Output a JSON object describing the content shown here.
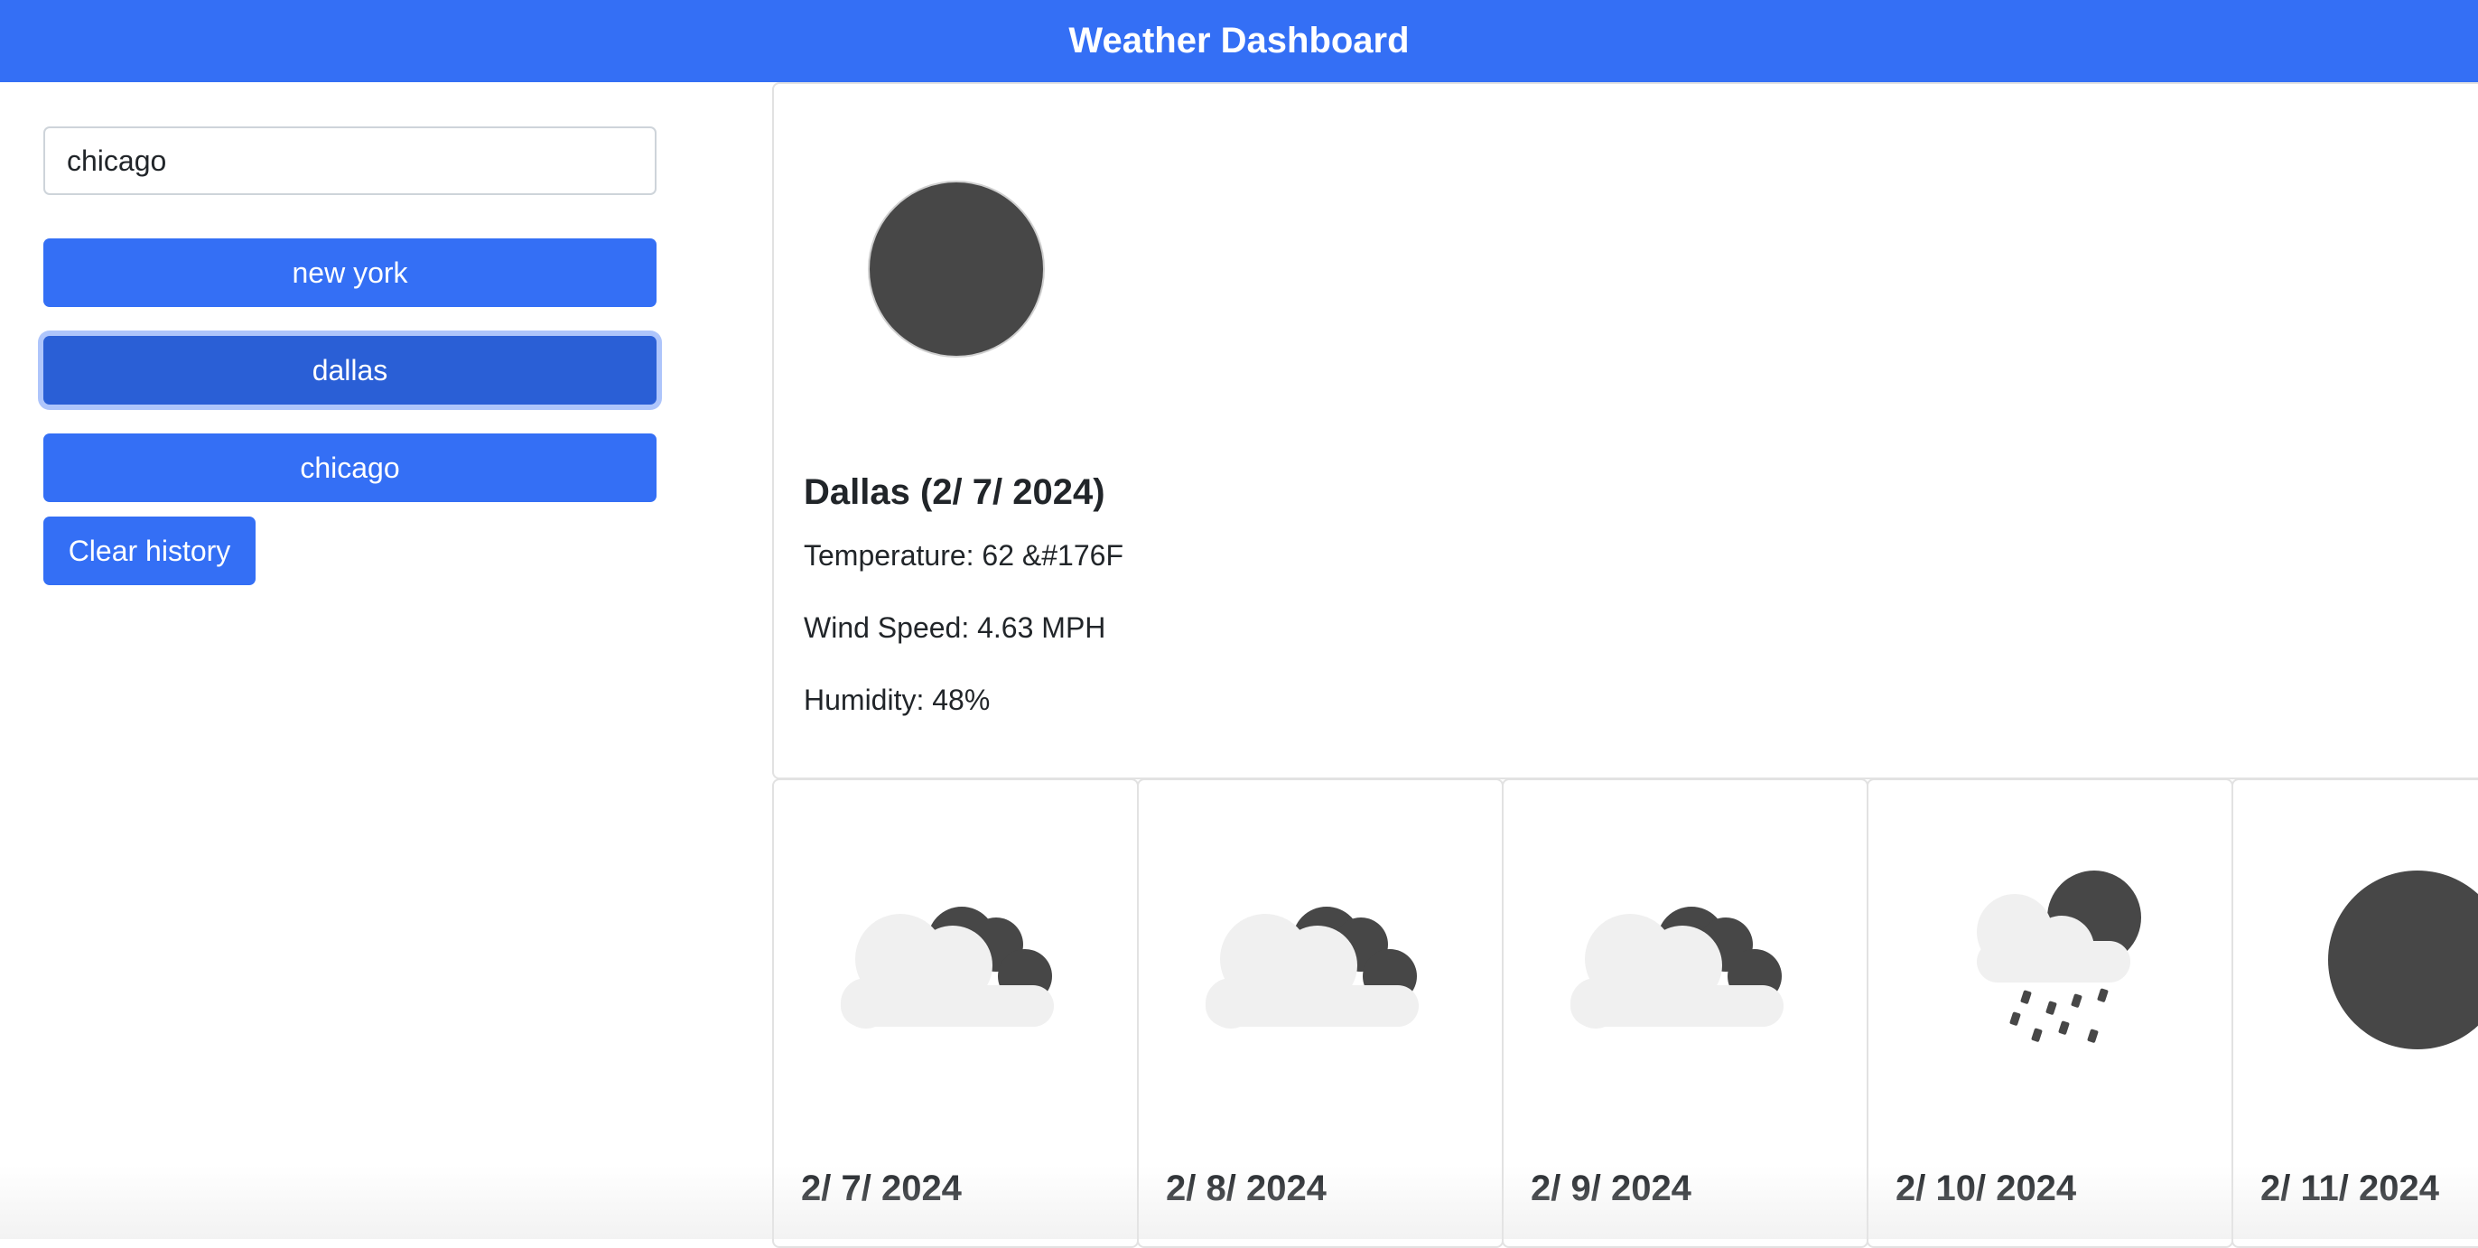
{
  "header": {
    "title": "Weather Dashboard"
  },
  "search": {
    "value": "chicago"
  },
  "history": [
    {
      "label": "new york"
    },
    {
      "label": "dallas"
    },
    {
      "label": "chicago"
    }
  ],
  "clear_label": "Clear history",
  "current": {
    "title": "Dallas (2/ 7/ 2024)",
    "temperature": "Temperature: 62 &#176F",
    "wind": "Wind Speed: 4.63 MPH",
    "humidity": "Humidity: 48%",
    "icon": "clear-night-icon"
  },
  "forecast": [
    {
      "date": "2/ 7/ 2024",
      "icon": "partly-cloudy-night-icon"
    },
    {
      "date": "2/ 8/ 2024",
      "icon": "partly-cloudy-night-icon"
    },
    {
      "date": "2/ 9/ 2024",
      "icon": "partly-cloudy-night-icon"
    },
    {
      "date": "2/ 10/ 2024",
      "icon": "rain-night-icon"
    },
    {
      "date": "2/ 11/ 2024",
      "icon": "clear-night-icon"
    }
  ],
  "colors": {
    "accent": "#346ff5",
    "accent_active": "#2a5fd6",
    "icon_dark": "#474747",
    "cloud": "#f0f0f0"
  }
}
